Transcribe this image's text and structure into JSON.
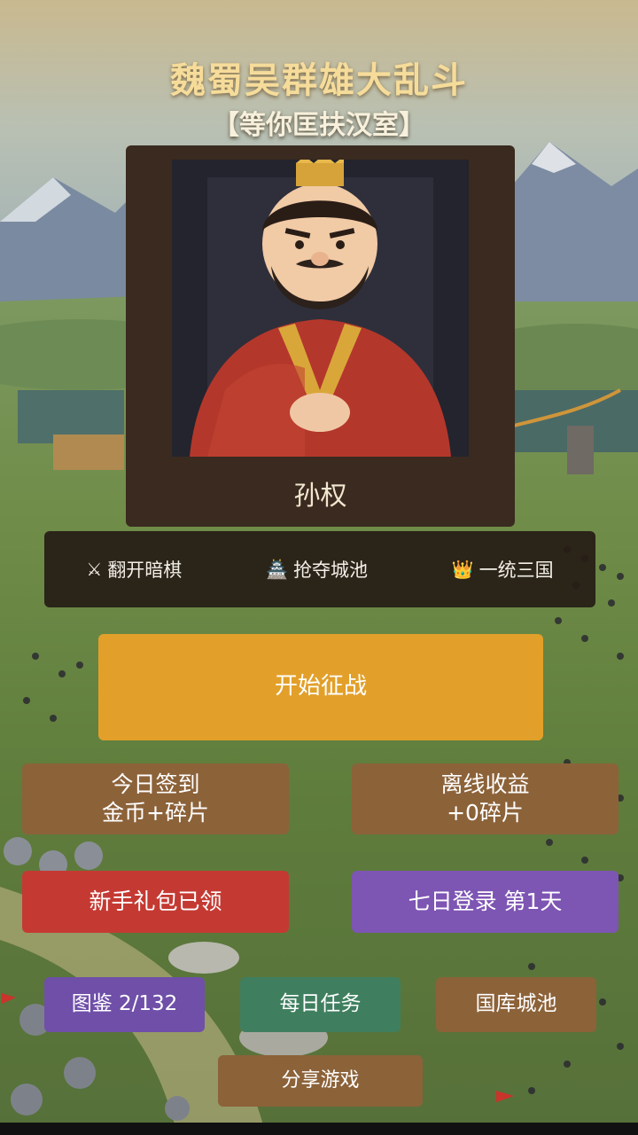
{
  "header": {
    "title": "魏蜀吴群雄大乱斗",
    "subtitle": "【等你匡扶汉室】"
  },
  "hero": {
    "name": "孙权",
    "portrait_icon": "emperor-portrait"
  },
  "features": [
    {
      "icon": "⚔",
      "icon_name": "crossed-swords-icon",
      "label": "翻开暗棋"
    },
    {
      "icon": "🏯",
      "icon_name": "castle-icon",
      "label": "抢夺城池"
    },
    {
      "icon": "👑",
      "icon_name": "crown-icon",
      "label": "一统三国"
    }
  ],
  "buttons": {
    "start": "开始征战",
    "checkin_line1": "今日签到",
    "checkin_line2": "金币+碎片",
    "offline_line1": "离线收益",
    "offline_line2": "+0碎片",
    "newbie": "新手礼包已领",
    "login7": "七日登录 第1天",
    "codex": "图鉴 2/132",
    "daily": "每日任务",
    "treasury": "国库城池",
    "share": "分享游戏"
  },
  "colors": {
    "start": "#e2a02a",
    "brown": "#8c6239",
    "red": "#c43a33",
    "purple": "#7d55b3",
    "green": "#3f7f5f",
    "title": "#f6dc9a"
  }
}
